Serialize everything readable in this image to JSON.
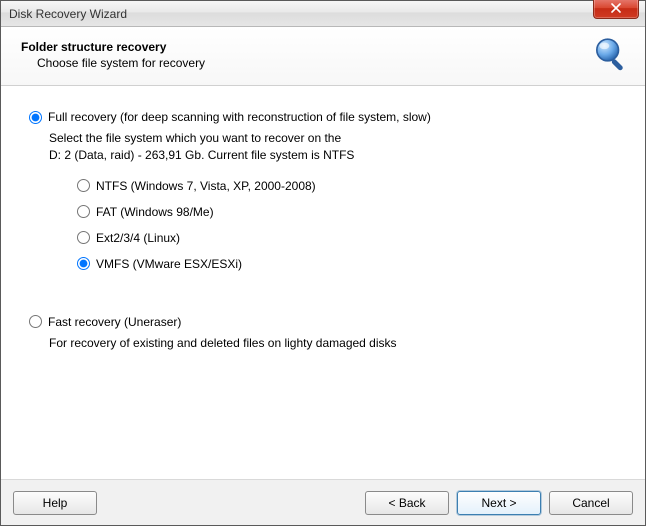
{
  "window": {
    "title": "Disk Recovery Wizard"
  },
  "header": {
    "title": "Folder structure recovery",
    "subtitle": "Choose file system for recovery"
  },
  "modes": {
    "full": {
      "label": "Full recovery (for deep scanning with reconstruction of file system, slow)",
      "desc_line1": "Select the file system which you want to recover on the",
      "desc_line2": "D: 2 (Data, raid) - 263,91 Gb. Current file system is NTFS",
      "selected": true
    },
    "fast": {
      "label": "Fast recovery (Uneraser)",
      "desc": "For recovery of existing and deleted files on lighty damaged disks",
      "selected": false
    }
  },
  "filesystems": [
    {
      "id": "ntfs",
      "label": "NTFS (Windows 7, Vista, XP, 2000-2008)",
      "selected": false
    },
    {
      "id": "fat",
      "label": "FAT (Windows 98/Me)",
      "selected": false
    },
    {
      "id": "ext",
      "label": "Ext2/3/4 (Linux)",
      "selected": false
    },
    {
      "id": "vmfs",
      "label": "VMFS (VMware ESX/ESXi)",
      "selected": true
    }
  ],
  "buttons": {
    "help": "Help",
    "back": "< Back",
    "next": "Next >",
    "cancel": "Cancel"
  }
}
